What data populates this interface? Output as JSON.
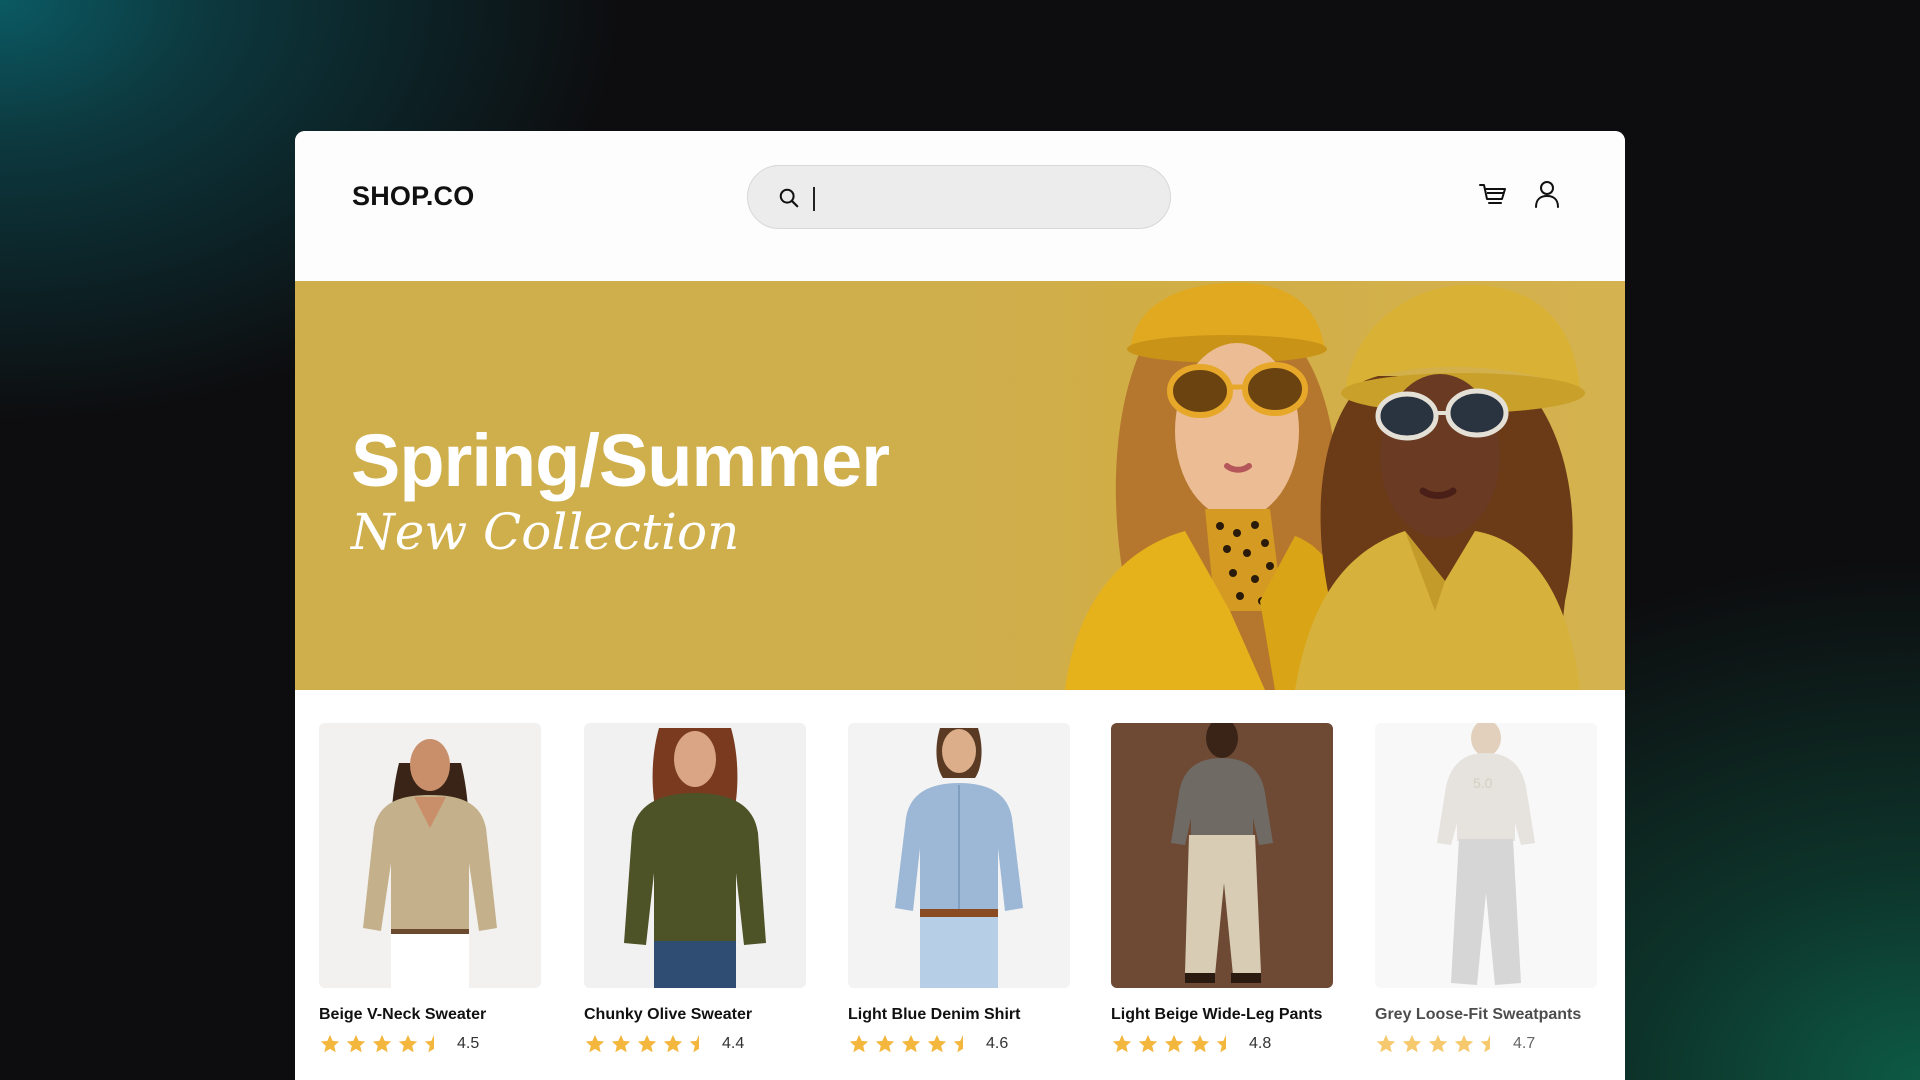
{
  "header": {
    "logo": "SHOP.CO",
    "search": {
      "value": "",
      "placeholder": ""
    },
    "icons": [
      "search-icon",
      "cart-icon",
      "user-icon"
    ]
  },
  "hero": {
    "title": "Spring/Summer",
    "subtitle": "New Collection",
    "background_color": "#cfae4c"
  },
  "products": [
    {
      "name": "Beige V-Neck Sweater",
      "rating": "4.5",
      "rating_value": 4.5,
      "garment_color": "#c4b08a",
      "photo_bg": "#f2f1ef"
    },
    {
      "name": "Chunky Olive Sweater",
      "rating": "4.4",
      "rating_value": 4.4,
      "garment_color": "#4e5227",
      "photo_bg": "#f2f1f1"
    },
    {
      "name": "Light Blue Denim Shirt",
      "rating": "4.6",
      "rating_value": 4.6,
      "garment_color": "#9cb8d6",
      "photo_bg": "#f3f3f3"
    },
    {
      "name": "Light Beige Wide-Leg Pants",
      "rating": "4.8",
      "rating_value": 4.8,
      "garment_color": "#d8cdb4",
      "photo_bg": "#6e4a35"
    },
    {
      "name": "Grey Loose-Fit Sweatpants",
      "rating": "4.7",
      "rating_value": 4.7,
      "garment_color": "#c9c9c9",
      "photo_bg": "#f6f6f6"
    }
  ],
  "colors": {
    "star": "#f4b73e",
    "accent": "#cfae4c"
  }
}
